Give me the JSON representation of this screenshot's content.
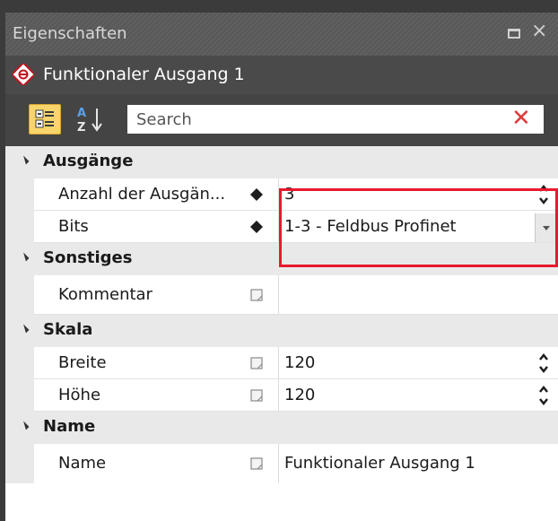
{
  "window": {
    "title": "Eigenschaften"
  },
  "object": {
    "title": "Funktionaler Ausgang 1"
  },
  "search": {
    "placeholder": "Search"
  },
  "grid": {
    "ausgaenge": {
      "label": "Ausgänge",
      "anzahl": {
        "label": "Anzahl der Ausgän...",
        "value": "3"
      },
      "bits": {
        "label": "Bits",
        "value": "1-3 - Feldbus Profinet"
      }
    },
    "sonstiges": {
      "label": "Sonstiges",
      "kommentar": {
        "label": "Kommentar",
        "value": ""
      }
    },
    "skala": {
      "label": "Skala",
      "breite": {
        "label": "Breite",
        "value": "120"
      },
      "hoehe": {
        "label": "Höhe",
        "value": "120"
      }
    },
    "name": {
      "label": "Name",
      "name": {
        "label": "Name",
        "value": "Funktionaler Ausgang 1"
      }
    }
  },
  "colors": {
    "highlight": "#e8192c",
    "clear_icon": "#e03a3a",
    "category_button": "#f7d56a"
  }
}
